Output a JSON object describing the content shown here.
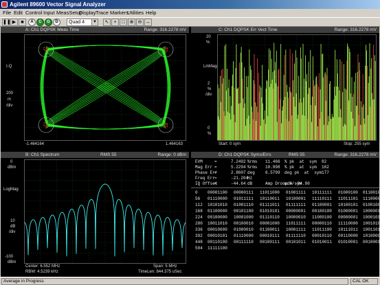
{
  "window": {
    "title": "Agilent 89600 Vector Signal Analyzer"
  },
  "menu": [
    "File",
    "Edit",
    "Control",
    "Input",
    "MeasSetup",
    "Display",
    "Trace",
    "Markers",
    "Utilities",
    "Help"
  ],
  "toolbar": {
    "buttons": [
      "pause-icon",
      "play-icon",
      "stop-icon",
      "record-icon",
      "autorange-A",
      "autorange-C",
      "autorange-G",
      "autorange-D"
    ],
    "labels": {
      "a": "A",
      "c": "C",
      "g": "G",
      "d": "D"
    },
    "layout_value": "Quad 4"
  },
  "pane_a": {
    "header": "A: Ch1 DQPSK Meas Time",
    "range": "Range: 316.2278 mV",
    "ylabel": "I-Q",
    "yunit": "200",
    "yunit2": "m",
    "ydiv": "/div",
    "xleft": "-1.464164",
    "xright": "1.464163"
  },
  "pane_c": {
    "header": "C: Ch1 DQPSK Err Vect Time",
    "range": "Range: 316.2278 mV",
    "ytop": "20",
    "ytop_unit": "%",
    "ylabel": "LinMag",
    "ymid": "2",
    "ymid_unit": "%",
    "ydiv": "/div",
    "ybottom": "0",
    "ybottom_unit": "%",
    "start": "Start: 0   sym",
    "stop": "Stop: 255  sym"
  },
  "pane_b": {
    "header": "B: Ch1 Spectrum",
    "rms": "RMS 55",
    "range": "Range: 0 dBm",
    "ytop": "0",
    "ytop_unit": "dBm",
    "ylabel": "LogMag",
    "ymid": "10",
    "ymid_unit": "dB",
    "ydiv": "/div",
    "ybottom": "-100",
    "ybottom_unit": "dBm",
    "center": "Center: 6.552 MHz",
    "span": "Span: 5 MHz",
    "rbw": "RBW: 4.5239 kHz",
    "timelen": "TimeLen: 844.375 uSec"
  },
  "pane_d": {
    "header": "D: Ch1 DQPSK Syms/Errs",
    "rms": "RMS 55",
    "range": "Range: 316.2278 mV",
    "metrics": [
      {
        "name": "EVM",
        "eq": "=",
        "val": "7.2402",
        "unit": "%rms",
        "v2": "11.466",
        "u2": "% pk  at  sym",
        "v3": "82"
      },
      {
        "name": "Mag Err",
        "eq": "=",
        "val": "5.2294",
        "unit": "%rms",
        "v2": "10.998",
        "u2": "% pk  at  sym",
        "v3": "162"
      },
      {
        "name": "Phase Err",
        "eq": "=",
        "val": "2.8607",
        "unit": "deg",
        "v2": "6.5799",
        "u2": "deg pk  at  sym",
        "v3": "177"
      },
      {
        "name": "Freq Err",
        "eq": "=",
        "val": "-21.204",
        "unit": "Hz",
        "v2": "",
        "u2": "",
        "v3": ""
      },
      {
        "name": "IQ Offset",
        "eq": "=",
        "val": "-44.64",
        "unit": "dB",
        "v2": "Amp Droop = -94.90",
        "u2": "udB/sym",
        "v3": ""
      }
    ],
    "symbols": [
      [
        "0",
        "00001100",
        "00000111",
        "11011000",
        "01001111",
        "10111111",
        "01000100",
        "01100100"
      ],
      [
        "56",
        "01110000",
        "01011111",
        "10110011",
        "10100001",
        "11110111",
        "11011101",
        "11100000"
      ],
      [
        "112",
        "10101010",
        "01001110",
        "01111011",
        "01111111",
        "01100001",
        "10100101",
        "01001000"
      ],
      [
        "168",
        "01100000",
        "00101100",
        "01010101",
        "00000001",
        "00100100",
        "01000001",
        "10000011"
      ],
      [
        "224",
        "00100000",
        "10001000",
        "01110110",
        "10000010",
        "11000100",
        "00000001",
        "10001011"
      ],
      [
        "280",
        "10011010",
        "00100010",
        "00001000",
        "11011111",
        "00000110",
        "11110000",
        "10010101"
      ],
      [
        "336",
        "00010000",
        "01000010",
        "01100011",
        "10001111",
        "11011100",
        "10111011",
        "10011011"
      ],
      [
        "392",
        "00010101",
        "01110000",
        "00010111",
        "01111110",
        "00010110",
        "00110000",
        "10100000"
      ],
      [
        "448",
        "00110100",
        "00111110",
        "00100111",
        "00101011",
        "01010011",
        "01010001",
        "00100010"
      ],
      [
        "504",
        "11111100",
        "",
        "",
        "",
        "",
        "",
        ""
      ]
    ]
  },
  "colors": {
    "trace_green": "#2aff2a",
    "trace_cyan": "#3cf0f0",
    "err_green": "#9be04a",
    "err_red": "#d84040",
    "grid": "#1f6a1f"
  },
  "status": {
    "left": "Average in Progress",
    "right": "CAL OK"
  }
}
